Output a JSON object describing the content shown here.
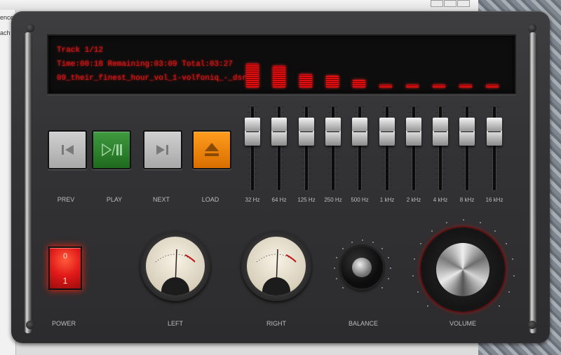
{
  "window": {
    "bg_fragments": [
      "ences",
      "ach"
    ]
  },
  "display": {
    "track_line": "Track 1/12",
    "time_label": "Time:",
    "time_value": "00:18",
    "remaining_label": "Remaining:",
    "remaining_value": "03:09",
    "total_label": "Total:",
    "total_value": "03:27",
    "filename": "09_their_finest_hour_vol_1-volfoniq_-_dsru..",
    "spectrum_levels": [
      0.85,
      0.78,
      0.48,
      0.42,
      0.28,
      0.1,
      0.1,
      0.1,
      0.1,
      0.1
    ],
    "color": "#d41414"
  },
  "transport": [
    {
      "label": "PREV",
      "icon": "skip-back-icon",
      "color": "grey"
    },
    {
      "label": "PLAY",
      "icon": "play-pause-icon",
      "color": "green"
    },
    {
      "label": "NEXT",
      "icon": "skip-forward-icon",
      "color": "grey"
    },
    {
      "label": "LOAD",
      "icon": "eject-icon",
      "color": "orange"
    }
  ],
  "equalizer": [
    {
      "label": "32 Hz",
      "level": 0.82
    },
    {
      "label": "64 Hz",
      "level": 0.82
    },
    {
      "label": "125 Hz",
      "level": 0.82
    },
    {
      "label": "250 Hz",
      "level": 0.82
    },
    {
      "label": "500 Hz",
      "level": 0.82
    },
    {
      "label": "1 kHz",
      "level": 0.82
    },
    {
      "label": "2 kHz",
      "level": 0.82
    },
    {
      "label": "4 kHz",
      "level": 0.82
    },
    {
      "label": "8 kHz",
      "level": 0.82
    },
    {
      "label": "16 kHz",
      "level": 0.82
    }
  ],
  "power": {
    "label": "POWER",
    "off_symbol": "0",
    "on_symbol": "1",
    "state": "on",
    "color": "#e01818"
  },
  "meters": [
    {
      "label": "LEFT",
      "level": 0.5
    },
    {
      "label": "RIGHT",
      "level": 0.5
    }
  ],
  "balance": {
    "label": "BALANCE"
  },
  "volume": {
    "label": "VOLUME",
    "accent": "#b01212"
  }
}
